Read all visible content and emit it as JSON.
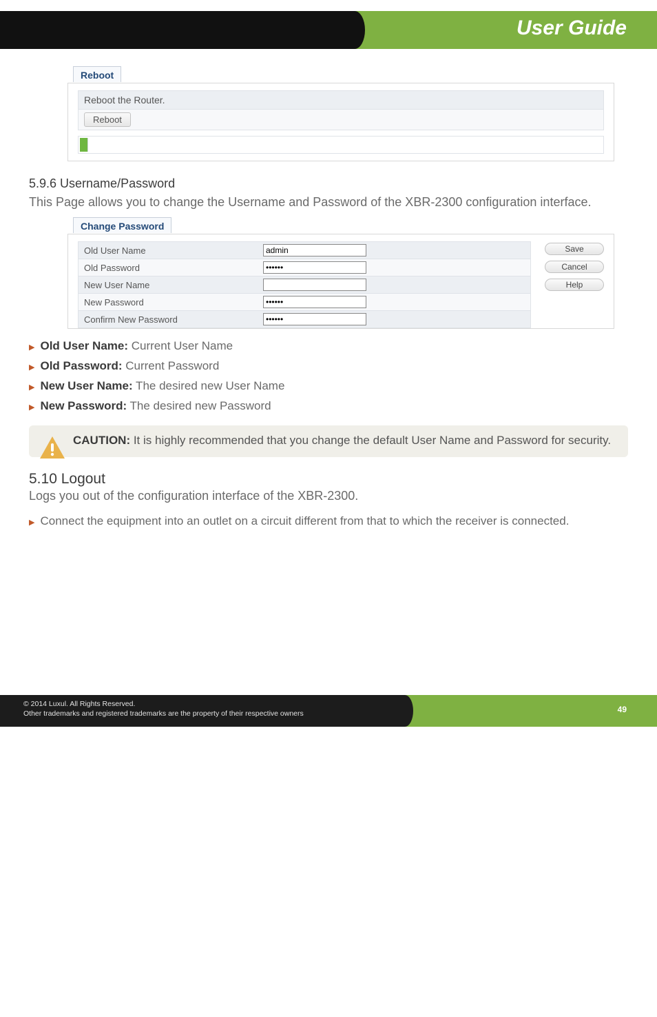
{
  "header": {
    "title": "User Guide"
  },
  "reboot_panel": {
    "tab": "Reboot",
    "heading": "Reboot the Router.",
    "button": "Reboot"
  },
  "section_596": {
    "heading": "5.9.6 Username/Password",
    "desc": "This Page allows you to change the Username and Password of the XBR-2300 configuration interface."
  },
  "change_password": {
    "tab": "Change Password",
    "rows": [
      {
        "label": "Old User Name",
        "value": "admin",
        "type": "text"
      },
      {
        "label": "Old Password",
        "value": "••••••",
        "type": "password"
      },
      {
        "label": "New User Name",
        "value": "",
        "type": "text"
      },
      {
        "label": "New Password",
        "value": "••••••",
        "type": "password"
      },
      {
        "label": "Confirm New Password",
        "value": "••••••",
        "type": "password"
      }
    ],
    "buttons": {
      "save": "Save",
      "cancel": "Cancel",
      "help": "Help"
    }
  },
  "bullets": [
    {
      "strong": "Old User Name:",
      "rest": " Current User Name"
    },
    {
      "strong": "Old Password:",
      "rest": " Current Password"
    },
    {
      "strong": "New User Name:",
      "rest": " The desired new User Name"
    },
    {
      "strong": "New Password:",
      "rest": " The desired new Password"
    }
  ],
  "caution": {
    "label": "CAUTION:",
    "text": " It is highly recommended that you change the default User Name and Password for security."
  },
  "logout": {
    "heading": "5.10 Logout",
    "desc": "Logs you out of the configuration interface of the XBR-2300.",
    "bullet": "Connect the equipment into an outlet on a circuit different from that to which the receiver is connected."
  },
  "footer": {
    "line1": "© 2014  Luxul. All Rights Reserved.",
    "line2": "Other trademarks and registered trademarks are the property of their respective owners",
    "page": "49"
  }
}
